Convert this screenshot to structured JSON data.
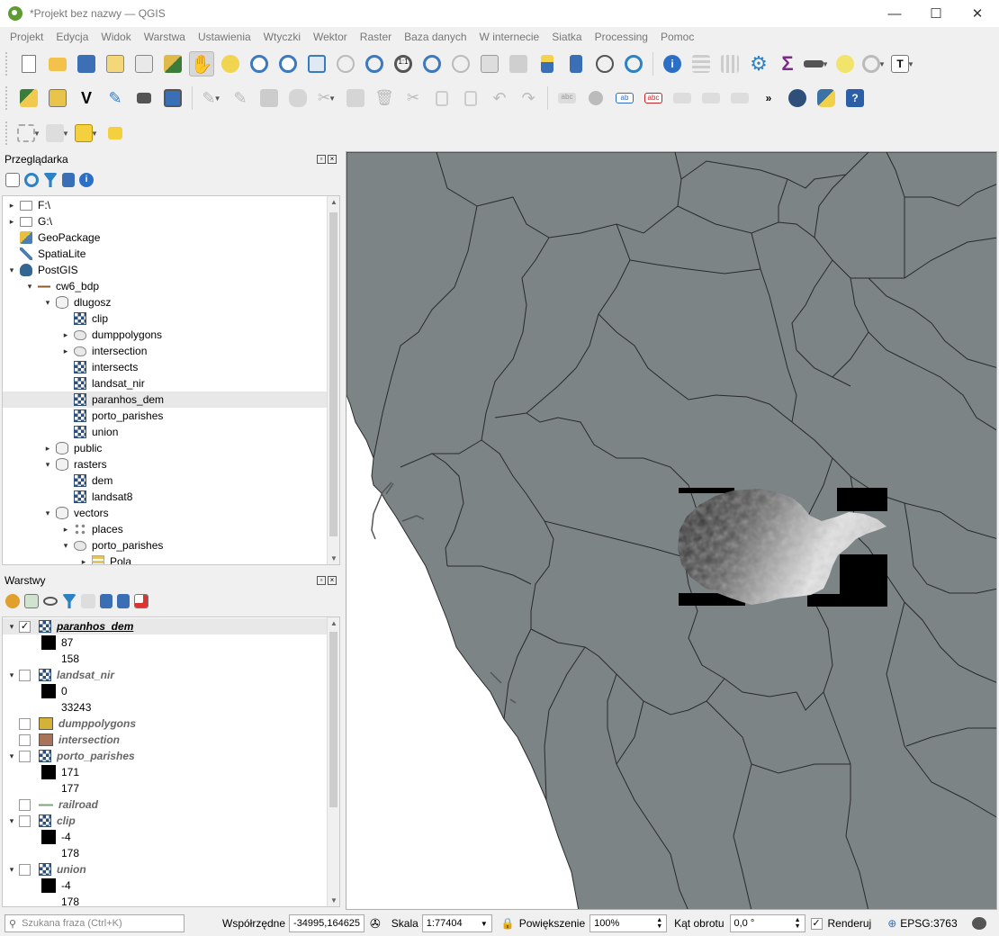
{
  "window": {
    "title": "*Projekt bez nazwy — QGIS",
    "minimize": "—",
    "maximize": "☐",
    "close": "✕"
  },
  "menu": [
    "Projekt",
    "Edycja",
    "Widok",
    "Warstwa",
    "Ustawienia",
    "Wtyczki",
    "Wektor",
    "Raster",
    "Baza danych",
    "W internecie",
    "Siatka",
    "Processing",
    "Pomoc"
  ],
  "browser": {
    "title": "Przeglądarka",
    "items": [
      {
        "label": "F:\\",
        "indent": 0,
        "arrow": "▸",
        "icon": "folder-icon"
      },
      {
        "label": "G:\\",
        "indent": 0,
        "arrow": "▸",
        "icon": "folder-icon"
      },
      {
        "label": "GeoPackage",
        "indent": 0,
        "arrow": "",
        "icon": "geopackage-icon"
      },
      {
        "label": "SpatiaLite",
        "indent": 0,
        "arrow": "",
        "icon": "spatialite-icon"
      },
      {
        "label": "PostGIS",
        "indent": 0,
        "arrow": "▾",
        "icon": "postgis-elephant-icon"
      },
      {
        "label": "cw6_bdp",
        "indent": 1,
        "arrow": "▾",
        "icon": "connection-icon"
      },
      {
        "label": "dlugosz",
        "indent": 2,
        "arrow": "▾",
        "icon": "schema-icon"
      },
      {
        "label": "clip",
        "indent": 3,
        "arrow": "",
        "icon": "raster-layer-icon"
      },
      {
        "label": "dumppolygons",
        "indent": 3,
        "arrow": "▸",
        "icon": "polygon-layer-icon"
      },
      {
        "label": "intersection",
        "indent": 3,
        "arrow": "▸",
        "icon": "polygon-layer-icon"
      },
      {
        "label": "intersects",
        "indent": 3,
        "arrow": "",
        "icon": "raster-layer-icon"
      },
      {
        "label": "landsat_nir",
        "indent": 3,
        "arrow": "",
        "icon": "raster-layer-icon"
      },
      {
        "label": "paranhos_dem",
        "indent": 3,
        "arrow": "",
        "icon": "raster-layer-icon",
        "selected": true
      },
      {
        "label": "porto_parishes",
        "indent": 3,
        "arrow": "",
        "icon": "raster-layer-icon"
      },
      {
        "label": "union",
        "indent": 3,
        "arrow": "",
        "icon": "raster-layer-icon"
      },
      {
        "label": "public",
        "indent": 2,
        "arrow": "▸",
        "icon": "schema-icon"
      },
      {
        "label": "rasters",
        "indent": 2,
        "arrow": "▾",
        "icon": "schema-icon"
      },
      {
        "label": "dem",
        "indent": 3,
        "arrow": "",
        "icon": "raster-layer-icon"
      },
      {
        "label": "landsat8",
        "indent": 3,
        "arrow": "",
        "icon": "raster-layer-icon"
      },
      {
        "label": "vectors",
        "indent": 2,
        "arrow": "▾",
        "icon": "schema-icon"
      },
      {
        "label": "places",
        "indent": 3,
        "arrow": "▸",
        "icon": "point-layer-icon"
      },
      {
        "label": "porto_parishes",
        "indent": 3,
        "arrow": "▾",
        "icon": "polygon-layer-icon"
      },
      {
        "label": "Pola",
        "indent": 4,
        "arrow": "▸",
        "icon": "fields-icon"
      }
    ]
  },
  "layers": {
    "title": "Warstwy",
    "items": [
      {
        "type": "layer",
        "label": "paranhos_dem",
        "checked": true,
        "arrow": "▾",
        "icon": "raster-layer-icon",
        "active": true
      },
      {
        "type": "value",
        "label": "87",
        "swatch": "#000000"
      },
      {
        "type": "value",
        "label": "158",
        "swatch": ""
      },
      {
        "type": "layer",
        "label": "landsat_nir",
        "checked": false,
        "arrow": "▾",
        "icon": "raster-layer-icon"
      },
      {
        "type": "value",
        "label": "0",
        "swatch": "#000000"
      },
      {
        "type": "value",
        "label": "33243",
        "swatch": ""
      },
      {
        "type": "layer",
        "label": "dumppolygons",
        "checked": false,
        "arrow": "",
        "icon": "fill-swatch",
        "fill": "#d4b23a"
      },
      {
        "type": "layer",
        "label": "intersection",
        "checked": false,
        "arrow": "",
        "icon": "fill-swatch",
        "fill": "#a8735a"
      },
      {
        "type": "layer",
        "label": "porto_parishes",
        "checked": false,
        "arrow": "▾",
        "icon": "raster-layer-icon"
      },
      {
        "type": "value",
        "label": "171",
        "swatch": "#000000"
      },
      {
        "type": "value",
        "label": "177",
        "swatch": ""
      },
      {
        "type": "layer",
        "label": "railroad",
        "checked": false,
        "arrow": "",
        "icon": "line-swatch"
      },
      {
        "type": "layer",
        "label": "clip",
        "checked": false,
        "arrow": "▾",
        "icon": "raster-layer-icon"
      },
      {
        "type": "value",
        "label": "-4",
        "swatch": "#000000"
      },
      {
        "type": "value",
        "label": "178",
        "swatch": ""
      },
      {
        "type": "layer",
        "label": "union",
        "checked": false,
        "arrow": "▾",
        "icon": "raster-layer-icon"
      },
      {
        "type": "value",
        "label": "-4",
        "swatch": "#000000"
      },
      {
        "type": "value",
        "label": "178",
        "swatch": ""
      }
    ]
  },
  "status": {
    "search_placeholder": "Szukana fraza (Ctrl+K)",
    "coord_label": "Współrzędne",
    "coord_value": "-34995,164625",
    "scale_label": "Skala",
    "scale_value": "1:77404",
    "magnifier_label": "Powiększenie",
    "magnifier_value": "100%",
    "rotation_label": "Kąt obrotu",
    "rotation_value": "0,0 °",
    "render_label": "Renderuj",
    "render_checked": true,
    "crs": "EPSG:3763"
  },
  "colors": {
    "map_fill": "#7c8486",
    "map_stroke": "#2a2a2a",
    "map_sea": "#ffffff",
    "qgis_green": "#5d9c31"
  }
}
